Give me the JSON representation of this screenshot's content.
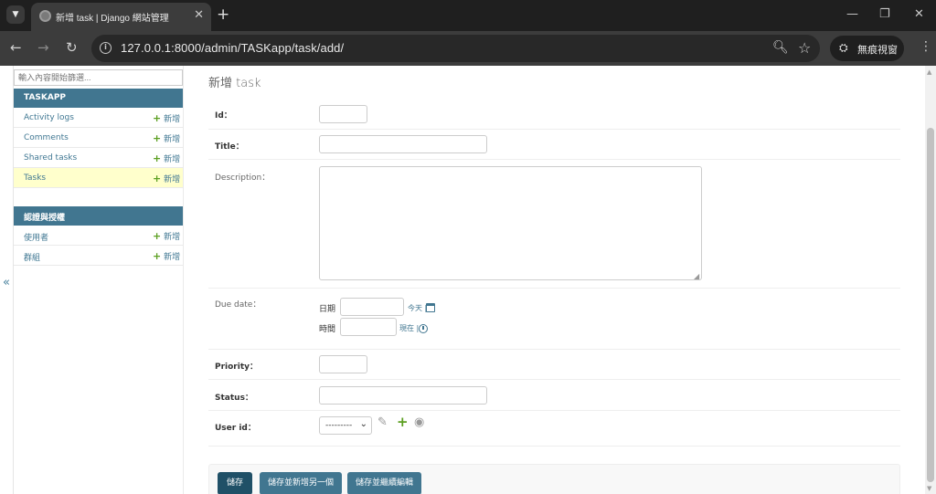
{
  "browser": {
    "tab_title": "新增 task | Django 網站管理",
    "url": "127.0.0.1:8000/admin/TASKapp/task/add/",
    "incognito_label": "無痕視窗",
    "icons": [
      "tab-menu-icon",
      "favicon-icon",
      "tab-close-icon",
      "new-tab-icon",
      "minimize-icon",
      "restore-icon",
      "window-close-icon",
      "back-icon",
      "forward-icon",
      "reload-icon",
      "site-info-icon",
      "zoom-icon",
      "bookmark-star-icon",
      "incognito-icon",
      "kebab-menu-icon"
    ]
  },
  "sidebar": {
    "filter_placeholder": "輸入內容開始篩選...",
    "collapse_glyph": "«",
    "modules": [
      {
        "caption": "TASKAPP",
        "rows": [
          {
            "label": "Activity logs",
            "add": "新增",
            "current": false
          },
          {
            "label": "Comments",
            "add": "新增",
            "current": false
          },
          {
            "label": "Shared tasks",
            "add": "新增",
            "current": false
          },
          {
            "label": "Tasks",
            "add": "新增",
            "current": true
          }
        ]
      },
      {
        "caption": "認證與授權",
        "rows": [
          {
            "label": "使用者",
            "add": "新增",
            "current": false
          },
          {
            "label": "群組",
            "add": "新增",
            "current": false
          }
        ]
      }
    ]
  },
  "form": {
    "title": "新增 task",
    "fields": {
      "id": {
        "label": "Id：",
        "value": ""
      },
      "title": {
        "label": "Title：",
        "value": ""
      },
      "description": {
        "label": "Description：",
        "value": ""
      },
      "due_date": {
        "label": "Due date：",
        "date_label": "日期",
        "date_value": "",
        "today": "今天",
        "time_label": "時間",
        "time_value": "",
        "now": "現在"
      },
      "priority": {
        "label": "Priority：",
        "value": ""
      },
      "status": {
        "label": "Status：",
        "value": ""
      },
      "user_id": {
        "label": "User id：",
        "selected": "---------"
      }
    },
    "buttons": {
      "save": "儲存",
      "save_add_another": "儲存並新增另一個",
      "save_continue": "儲存並繼續編輯"
    }
  },
  "colors": {
    "accent": "#417690",
    "accent_dark": "#205067",
    "current_row": "#ffffcc",
    "add_plus": "#5c9f21"
  }
}
